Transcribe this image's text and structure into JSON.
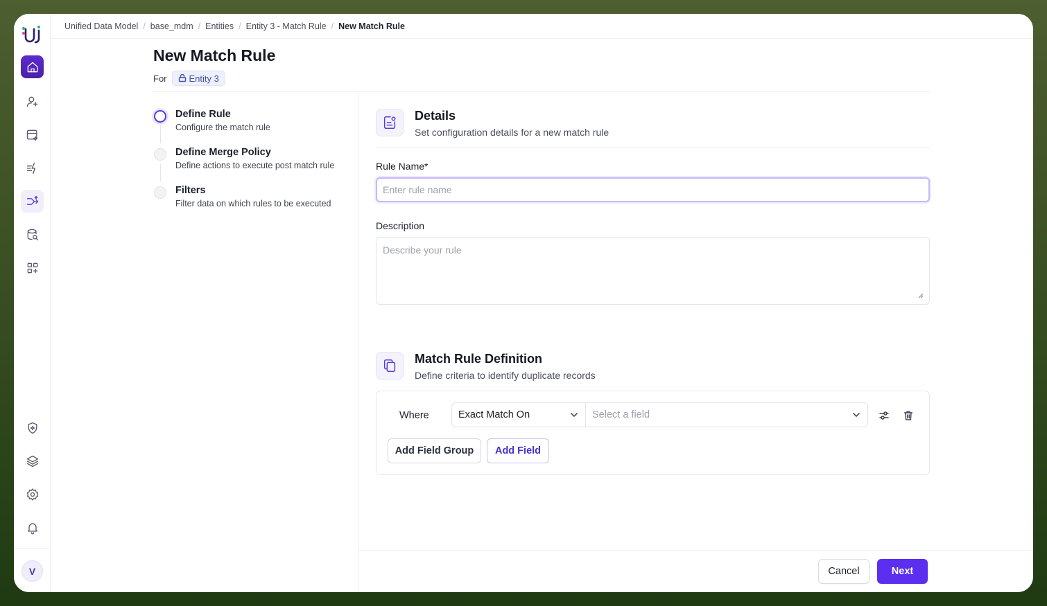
{
  "breadcrumb": {
    "items": [
      "Unified Data Model",
      "base_mdm",
      "Entities",
      "Entity 3 - Match Rule"
    ],
    "current": "New Match Rule"
  },
  "header": {
    "title": "New Match Rule",
    "for_label": "For",
    "entity_chip": "Entity 3"
  },
  "steps": [
    {
      "title": "Define Rule",
      "desc": "Configure the match rule",
      "state": "active"
    },
    {
      "title": "Define Merge Policy",
      "desc": "Define actions to execute post match rule",
      "state": "pending"
    },
    {
      "title": "Filters",
      "desc": "Filter data on which rules to be executed",
      "state": "pending"
    }
  ],
  "details": {
    "title": "Details",
    "subtitle": "Set configuration details for a new match rule",
    "rule_name_label": "Rule Name*",
    "rule_name_placeholder": "Enter rule name",
    "rule_name_value": "",
    "description_label": "Description",
    "description_placeholder": "Describe your rule",
    "description_value": ""
  },
  "match_rule": {
    "title": "Match Rule Definition",
    "subtitle": "Define criteria to identify duplicate records",
    "where_label": "Where",
    "match_type": "Exact Match On",
    "field_placeholder": "Select a field",
    "add_field_group": "Add Field Group",
    "add_field": "Add Field"
  },
  "footer": {
    "cancel": "Cancel",
    "next": "Next"
  },
  "sidebar": {
    "avatar_initial": "V",
    "icons": [
      "home-icon",
      "user-sparkle-icon",
      "table-sparkle-icon",
      "lightning-icon",
      "merge-sparkle-icon",
      "database-search-icon",
      "apps-add-icon",
      "shield-sparkle-icon",
      "layers-icon",
      "gear-icon",
      "bell-icon"
    ]
  },
  "colors": {
    "accent": "#5b2ef0",
    "sidebar_home": "#4b1fa8"
  }
}
